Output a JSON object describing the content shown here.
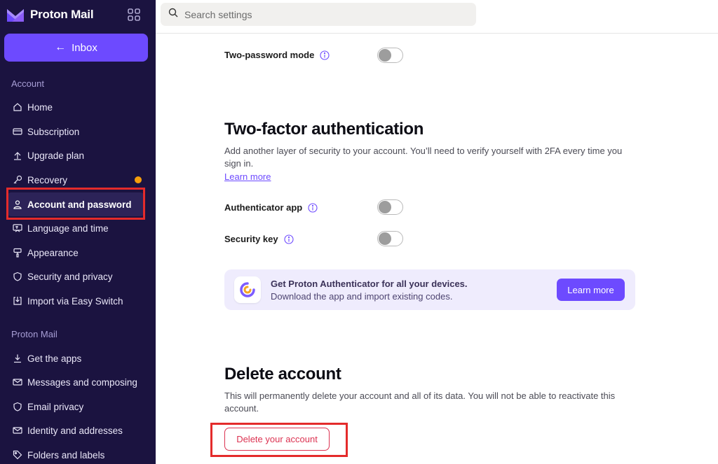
{
  "app": {
    "brand": "Proton Mail"
  },
  "sidebar": {
    "inbox_label": "Inbox",
    "account_section": "Account",
    "account_items": [
      {
        "label": "Home",
        "icon": "home-icon"
      },
      {
        "label": "Subscription",
        "icon": "card-icon"
      },
      {
        "label": "Upgrade plan",
        "icon": "upgrade-icon"
      },
      {
        "label": "Recovery",
        "icon": "key-icon",
        "badge": "notification-dot"
      },
      {
        "label": "Account and password",
        "icon": "user-icon",
        "active": true
      },
      {
        "label": "Language and time",
        "icon": "language-icon"
      },
      {
        "label": "Appearance",
        "icon": "brush-icon"
      },
      {
        "label": "Security and privacy",
        "icon": "shield-icon"
      },
      {
        "label": "Import via Easy Switch",
        "icon": "import-icon"
      }
    ],
    "mail_section": "Proton Mail",
    "mail_items": [
      {
        "label": "Get the apps",
        "icon": "download-icon"
      },
      {
        "label": "Messages and composing",
        "icon": "envelope-icon"
      },
      {
        "label": "Email privacy",
        "icon": "shield-icon"
      },
      {
        "label": "Identity and addresses",
        "icon": "envelope-icon"
      },
      {
        "label": "Folders and labels",
        "icon": "tag-icon"
      }
    ]
  },
  "search": {
    "placeholder": "Search settings"
  },
  "main": {
    "two_password_label": "Two-password mode",
    "twofa": {
      "title": "Two-factor authentication",
      "description": "Add another layer of security to your account. You’ll need to verify yourself with 2FA every time you sign in.",
      "learn_more": "Learn more",
      "authenticator_label": "Authenticator app",
      "security_key_label": "Security key"
    },
    "promo": {
      "title": "Get Proton Authenticator for all your devices.",
      "subtitle": "Download the app and import existing codes.",
      "button": "Learn more"
    },
    "delete": {
      "title": "Delete account",
      "description": "This will permanently delete your account and all of its data. You will not be able to reactivate this account.",
      "button": "Delete your account"
    }
  },
  "colors": {
    "sidebar_bg": "#1b1340",
    "accent": "#6d4aff",
    "danger": "#dc3251",
    "highlight": "#e42b2b",
    "badge": "#f59e0b"
  }
}
